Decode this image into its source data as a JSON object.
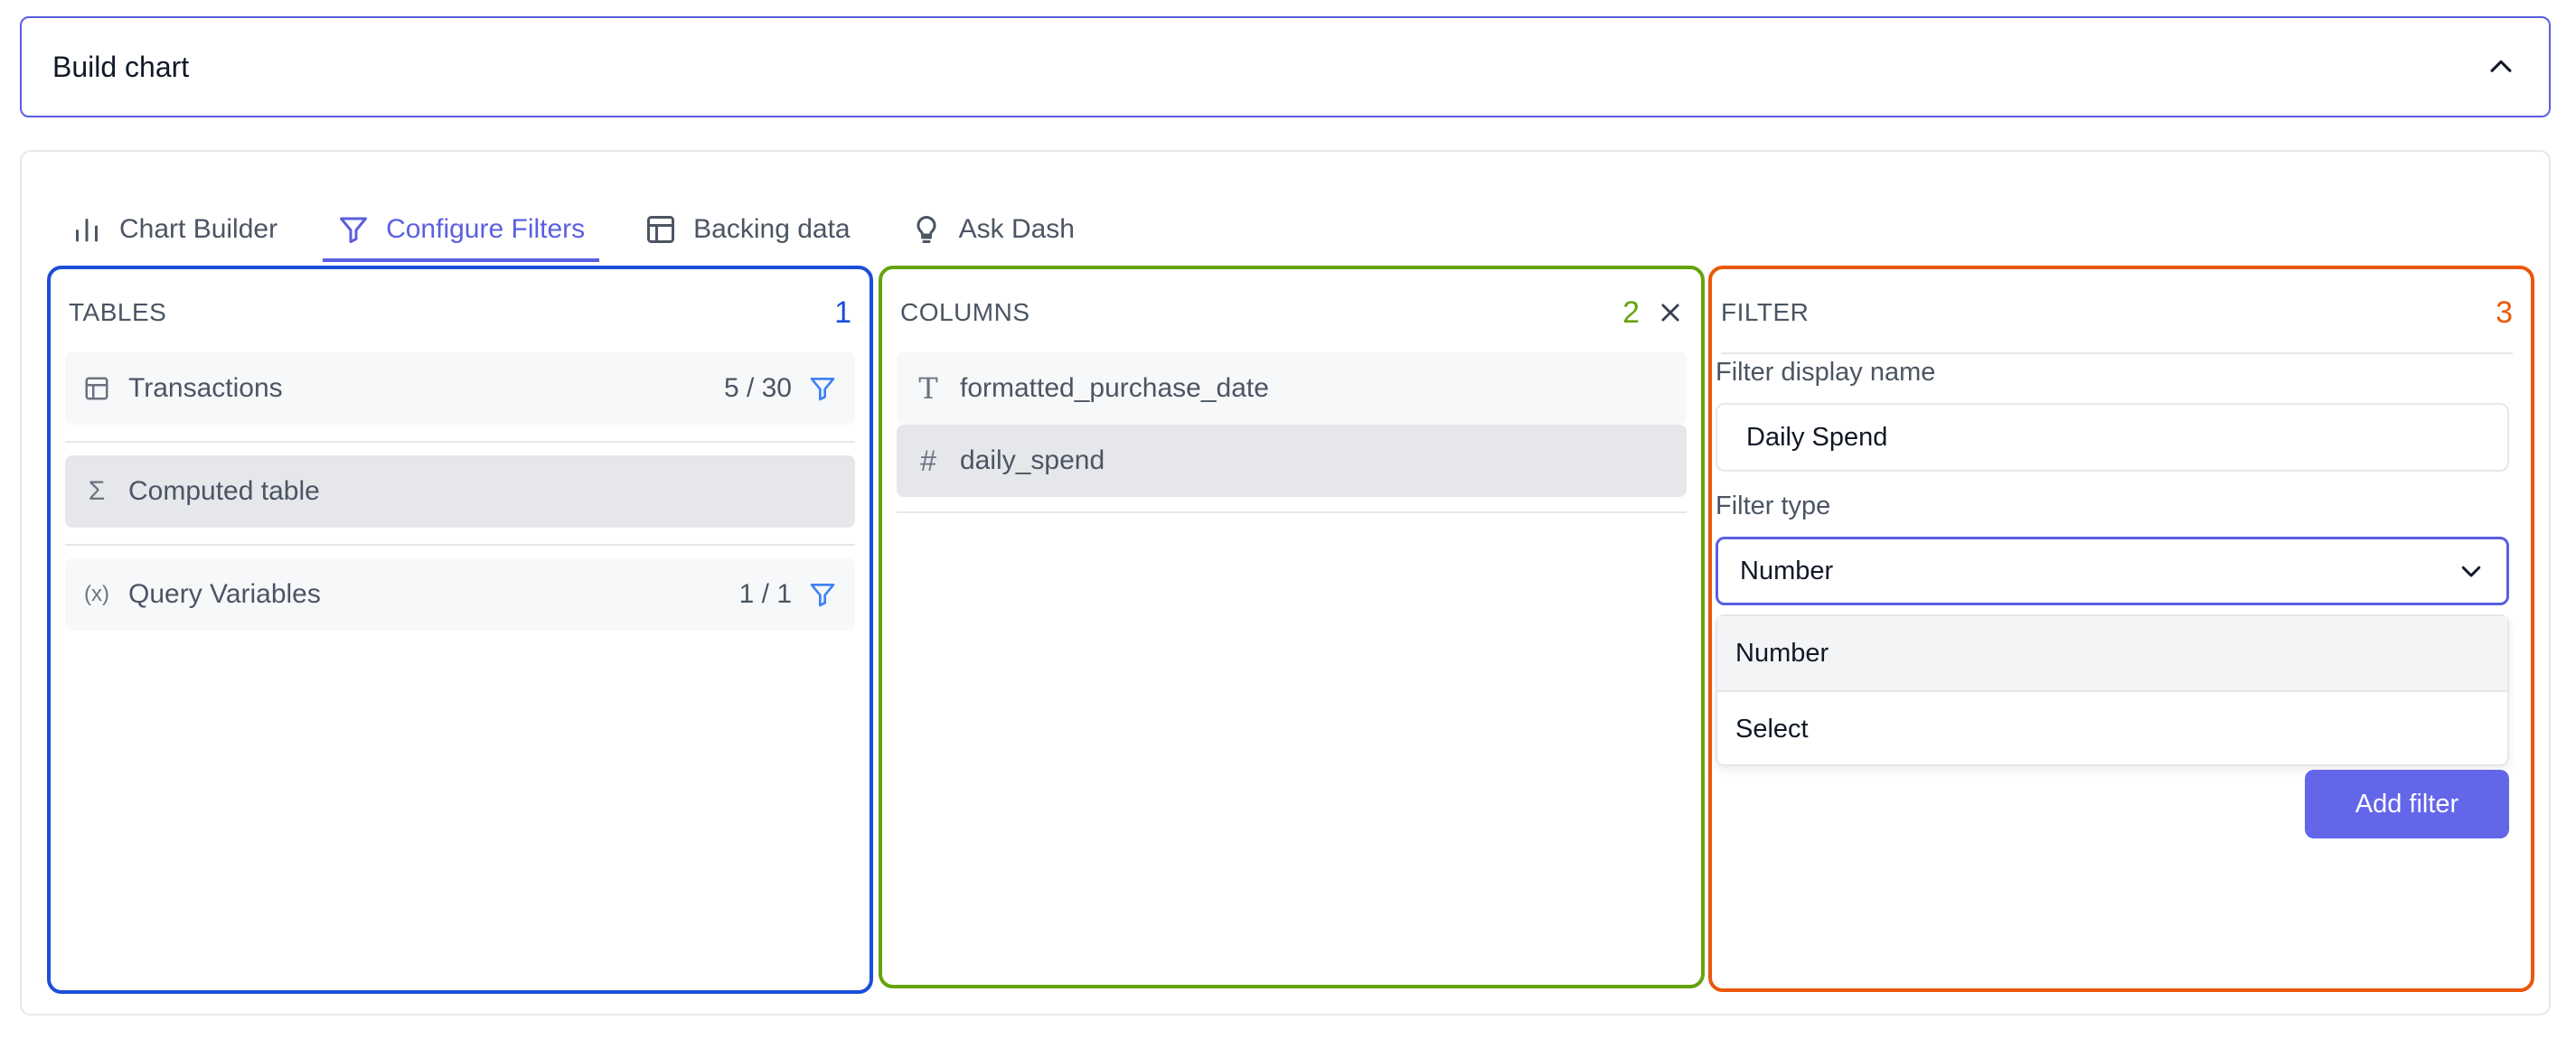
{
  "accordion": {
    "title": "Build chart",
    "accent": "#5b5fe0"
  },
  "tabs": [
    {
      "label": "Chart Builder",
      "icon": "bar-chart-icon"
    },
    {
      "label": "Configure Filters",
      "icon": "filter-icon",
      "active": true
    },
    {
      "label": "Backing data",
      "icon": "table-icon"
    },
    {
      "label": "Ask Dash",
      "icon": "lightbulb-icon"
    }
  ],
  "tables_panel": {
    "title": "TABLES",
    "number": "1",
    "color": "#1d4ed8",
    "items": [
      {
        "label": "Transactions",
        "icon": "table-grid-icon",
        "count": "5 / 30"
      },
      {
        "label": "Computed table",
        "icon": "sigma-icon",
        "selected": true
      },
      {
        "label": "Query Variables",
        "icon": "variable-icon",
        "count": "1 / 1"
      }
    ]
  },
  "columns_panel": {
    "title": "COLUMNS",
    "number": "2",
    "color": "#65a30d",
    "items": [
      {
        "label": "formatted_purchase_date",
        "icon": "text-type-icon"
      },
      {
        "label": "daily_spend",
        "icon": "hash-icon",
        "selected": true
      }
    ]
  },
  "filter_panel": {
    "title": "FILTER",
    "number": "3",
    "color": "#ea580c",
    "display_name_label": "Filter display name",
    "display_name_value": "Daily Spend",
    "type_label": "Filter type",
    "type_value": "Number",
    "type_options": [
      "Number",
      "Select"
    ],
    "add_button": "Add filter"
  }
}
